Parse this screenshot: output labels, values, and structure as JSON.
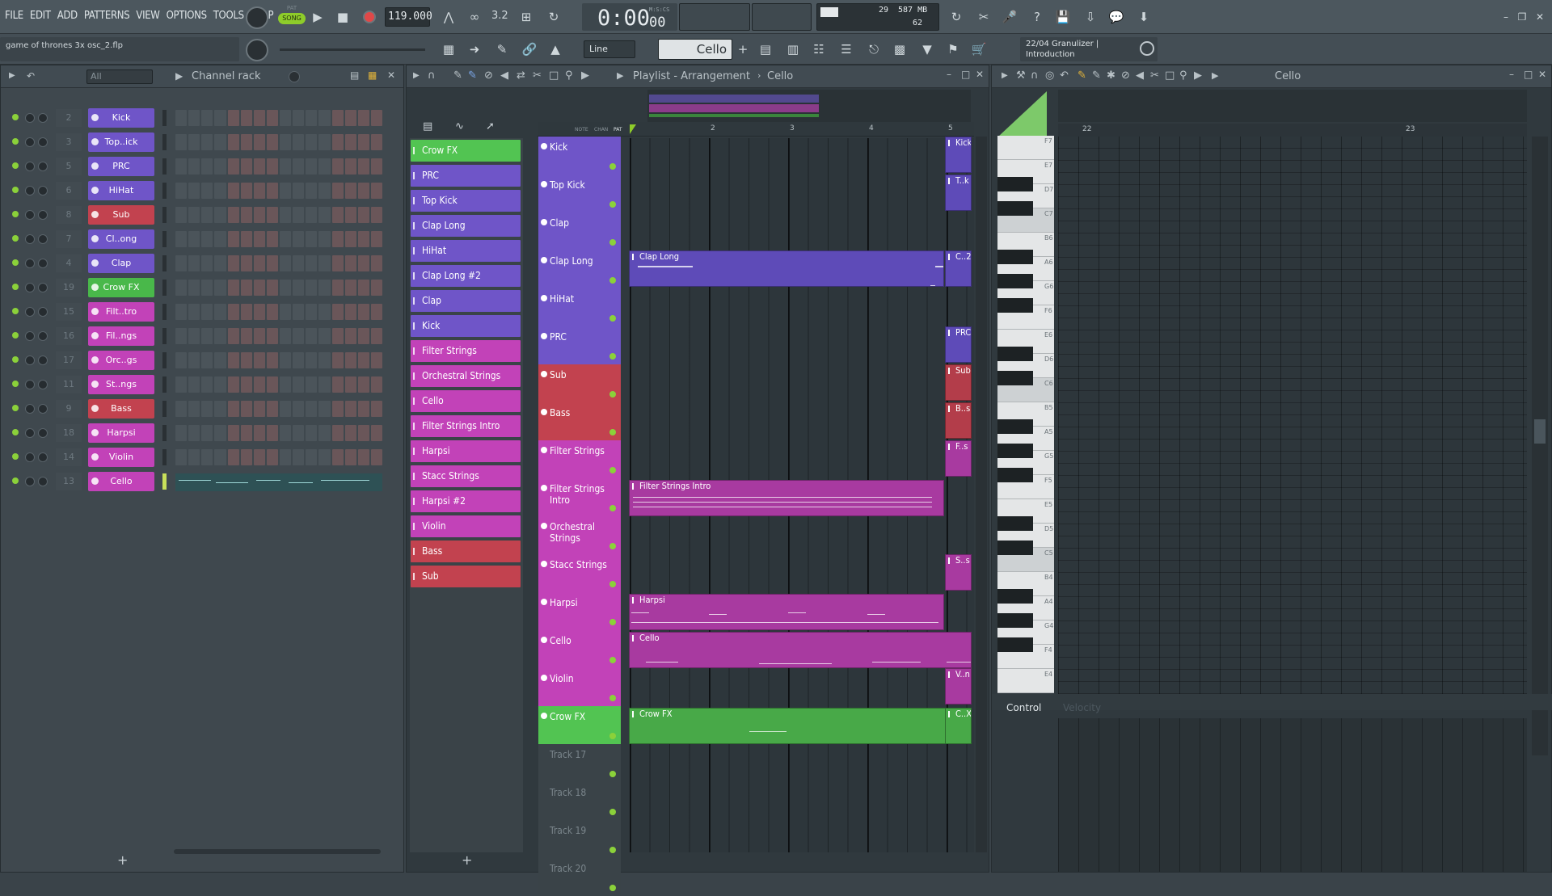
{
  "menu": [
    "FILE",
    "EDIT",
    "ADD",
    "PATTERNS",
    "VIEW",
    "OPTIONS",
    "TOOLS",
    "HELP"
  ],
  "transport": {
    "pat_label": "PAT",
    "song_label": "SONG",
    "tempo": "119.000",
    "time": "0:00",
    "time_sub": "00",
    "time_unit": "M:S:CS",
    "cpu": "29",
    "ram": "587 MB",
    "poly": "62",
    "mode_icon": "3.2"
  },
  "project_name": "game of thrones 3x osc_2.flp",
  "snap": "Line",
  "pattern_selector": "Cello",
  "hint": {
    "line1": "22/04  Granulizer |",
    "line2": "Introduction"
  },
  "channel_rack": {
    "title": "Channel rack",
    "filter": "All",
    "channels": [
      {
        "num": "2",
        "name": "Kick",
        "color": "#6f55c8"
      },
      {
        "num": "3",
        "name": "Top..ick",
        "color": "#6f55c8"
      },
      {
        "num": "5",
        "name": "PRC",
        "color": "#6f55c8"
      },
      {
        "num": "6",
        "name": "HiHat",
        "color": "#6f55c8"
      },
      {
        "num": "8",
        "name": "Sub",
        "color": "#c2424f"
      },
      {
        "num": "7",
        "name": "Cl..ong",
        "color": "#6f55c8"
      },
      {
        "num": "4",
        "name": "Clap",
        "color": "#6f55c8"
      },
      {
        "num": "19",
        "name": "Crow FX",
        "color": "#49b84a"
      },
      {
        "num": "15",
        "name": "Filt..tro",
        "color": "#c242b8"
      },
      {
        "num": "16",
        "name": "Fil..ngs",
        "color": "#c242b8"
      },
      {
        "num": "17",
        "name": "Orc..gs",
        "color": "#c242b8"
      },
      {
        "num": "11",
        "name": "St..ngs",
        "color": "#c242b8"
      },
      {
        "num": "9",
        "name": "Bass",
        "color": "#c2424f"
      },
      {
        "num": "18",
        "name": "Harpsi",
        "color": "#c242b8"
      },
      {
        "num": "14",
        "name": "Violin",
        "color": "#c242b8"
      },
      {
        "num": "13",
        "name": "Cello",
        "color": "#c242b8"
      }
    ],
    "add_label": "+"
  },
  "playlist": {
    "title": "Playlist - Arrangement",
    "breadcrumb": "Cello",
    "header_labels": [
      "NOTE",
      "CHAN",
      "PAT"
    ],
    "bars": [
      "2",
      "3",
      "4",
      "5"
    ],
    "patterns": [
      {
        "name": "Crow FX",
        "color": "#49b84a"
      },
      {
        "name": "PRC",
        "color": "#6f55c8"
      },
      {
        "name": "Top Kick",
        "color": "#6f55c8"
      },
      {
        "name": "Clap Long",
        "color": "#6f55c8"
      },
      {
        "name": "HiHat",
        "color": "#6f55c8"
      },
      {
        "name": "Clap Long #2",
        "color": "#6f55c8"
      },
      {
        "name": "Clap",
        "color": "#6f55c8"
      },
      {
        "name": "Kick",
        "color": "#6f55c8"
      },
      {
        "name": "Filter Strings",
        "color": "#c242b8"
      },
      {
        "name": "Orchestral Strings",
        "color": "#c242b8"
      },
      {
        "name": "Cello",
        "color": "#c242b8"
      },
      {
        "name": "Filter Strings Intro",
        "color": "#c242b8"
      },
      {
        "name": "Harpsi",
        "color": "#c242b8"
      },
      {
        "name": "Stacc Strings",
        "color": "#c242b8"
      },
      {
        "name": "Harpsi #2",
        "color": "#c242b8"
      },
      {
        "name": "Violin",
        "color": "#c242b8"
      },
      {
        "name": "Bass",
        "color": "#c2424f"
      },
      {
        "name": "Sub",
        "color": "#c2424f"
      }
    ],
    "tracks": [
      {
        "name": "Kick",
        "color": "#6f55c8"
      },
      {
        "name": "Top Kick",
        "color": "#6f55c8"
      },
      {
        "name": "Clap",
        "color": "#6f55c8"
      },
      {
        "name": "Clap Long",
        "color": "#6f55c8"
      },
      {
        "name": "HiHat",
        "color": "#6f55c8"
      },
      {
        "name": "PRC",
        "color": "#6f55c8"
      },
      {
        "name": "Sub",
        "color": "#c2424f"
      },
      {
        "name": "Bass",
        "color": "#c2424f"
      },
      {
        "name": "Filter Strings",
        "color": "#c242b8"
      },
      {
        "name": "Filter Strings Intro",
        "color": "#c242b8"
      },
      {
        "name": "Orchestral Strings",
        "color": "#c242b8"
      },
      {
        "name": "Stacc Strings",
        "color": "#c242b8"
      },
      {
        "name": "Harpsi",
        "color": "#c242b8"
      },
      {
        "name": "Cello",
        "color": "#c242b8"
      },
      {
        "name": "Violin",
        "color": "#c242b8"
      },
      {
        "name": "Crow FX",
        "color": "#49b84a"
      },
      {
        "name": "Track 17",
        "color": ""
      },
      {
        "name": "Track 18",
        "color": ""
      },
      {
        "name": "Track 19",
        "color": ""
      },
      {
        "name": "Track 20",
        "color": ""
      }
    ],
    "clips": {
      "clap_long": "Clap Long",
      "filter_strings_intro": "Filter Strings Intro",
      "harpsi": "Harpsi",
      "cello": "Cello",
      "crow_fx": "Crow FX",
      "right_edge": [
        "Kick",
        "T..k",
        "C..2",
        "PRC",
        "Sub",
        "B..s",
        "F..s",
        "S..s",
        "V..n",
        "C..X"
      ]
    }
  },
  "piano_roll": {
    "title": "Cello",
    "bars": [
      "22",
      "23"
    ],
    "notes": [
      "F7",
      "E7",
      "D7",
      "C7",
      "B6",
      "A6",
      "G6",
      "F6",
      "E6",
      "D6",
      "C6",
      "B5",
      "A5",
      "G5",
      "F5",
      "E5",
      "D5",
      "C5",
      "B4",
      "A4",
      "G4",
      "F4",
      "E4"
    ],
    "control_label": "Control",
    "control_target": "Velocity"
  }
}
